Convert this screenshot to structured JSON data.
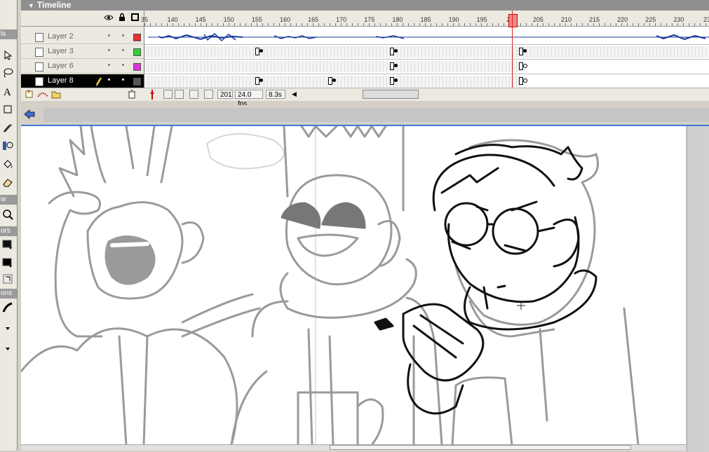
{
  "tools_panel": {
    "header": "ls",
    "view_section": "w",
    "colors_section": "ors",
    "options_section": "ons"
  },
  "timeline": {
    "title": "Timeline",
    "ruler_labels": [
      "35",
      "140",
      "145",
      "150",
      "155",
      "160",
      "165",
      "170",
      "175",
      "180",
      "185",
      "190",
      "195",
      "20",
      "205",
      "210",
      "215",
      "220",
      "225",
      "230",
      "23"
    ],
    "current_frame": "201",
    "frame_rate": "24.0 fps",
    "elapsed_time": "8.3s",
    "layers": [
      {
        "name": "Layer 2",
        "color": "#e53030",
        "selected": false
      },
      {
        "name": "Layer 3",
        "color": "#33cc33",
        "selected": false
      },
      {
        "name": "Layer 6",
        "color": "#dd33dd",
        "selected": false
      },
      {
        "name": "Layer 8",
        "color": "#555555",
        "selected": true
      }
    ]
  },
  "colors": {
    "accent": "#3a7bd5",
    "playhead": "#e02020",
    "timeline_header": "#8f8f8f"
  }
}
